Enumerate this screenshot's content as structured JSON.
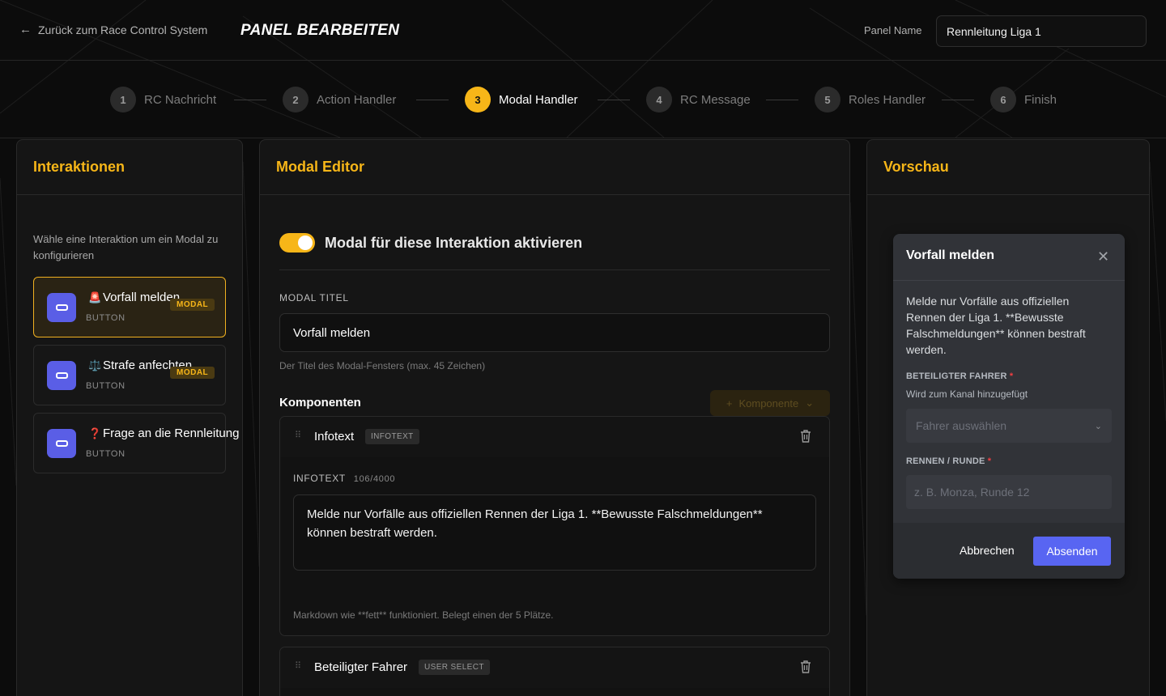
{
  "header": {
    "back_label": "Zurück zum Race Control System",
    "title": "PANEL BEARBEITEN",
    "panel_name_label": "Panel Name",
    "panel_name_value": "Rennleitung Liga 1"
  },
  "stepper": {
    "steps": [
      {
        "num": "1",
        "label": "RC Nachricht"
      },
      {
        "num": "2",
        "label": "Action Handler"
      },
      {
        "num": "3",
        "label": "Modal Handler"
      },
      {
        "num": "4",
        "label": "RC Message"
      },
      {
        "num": "5",
        "label": "Roles Handler"
      },
      {
        "num": "6",
        "label": "Finish"
      }
    ],
    "active_step": "3"
  },
  "interactions": {
    "title": "Interaktionen",
    "hint": "Wähle eine Interaktion um ein Modal zu konfigurieren",
    "items": [
      {
        "emoji": "🚨",
        "label": "Vorfall melden",
        "type": "BUTTON",
        "badge": "MODAL"
      },
      {
        "emoji": "⚖️",
        "label": "Strafe anfechten",
        "type": "BUTTON",
        "badge": "MODAL"
      },
      {
        "emoji": "❓",
        "label": "Frage an die Rennleitung",
        "type": "BUTTON",
        "badge": ""
      }
    ]
  },
  "editor": {
    "title": "Modal Editor",
    "toggle_label": "Modal für diese Interaktion aktivieren",
    "modal_title_label": "MODAL TITEL",
    "modal_title_value": "Vorfall melden",
    "modal_title_help": "Der Titel des Modal-Fensters (max. 45 Zeichen)",
    "components_heading": "Komponenten",
    "add_component_label": "Komponente",
    "components": [
      {
        "name": "Infotext",
        "tag": "INFOTEXT",
        "field_label": "INFOTEXT",
        "counter": "106/4000",
        "value": "Melde nur Vorfälle aus offiziellen Rennen der Liga 1. **Bewusste Falschmeldungen** können bestraft werden.",
        "help": "Markdown wie **fett** funktioniert. Belegt einen der 5 Plätze."
      },
      {
        "name": "Beteiligter Fahrer",
        "tag": "USER SELECT"
      }
    ]
  },
  "preview": {
    "title": "Vorschau",
    "modal": {
      "title": "Vorfall melden",
      "body": "Melde nur Vorfälle aus offiziellen Rennen der Liga 1. **Bewusste Falschmeldungen** können bestraft werden.",
      "field1_label": "BETEILIGTER FAHRER",
      "field1_sub": "Wird zum Kanal hinzugefügt",
      "field1_placeholder": "Fahrer auswählen",
      "field2_label": "RENNEN / RUNDE",
      "field2_placeholder": "z. B. Monza, Runde 12",
      "required_mark": "*",
      "cancel_label": "Abbrechen",
      "submit_label": "Absenden"
    }
  }
}
